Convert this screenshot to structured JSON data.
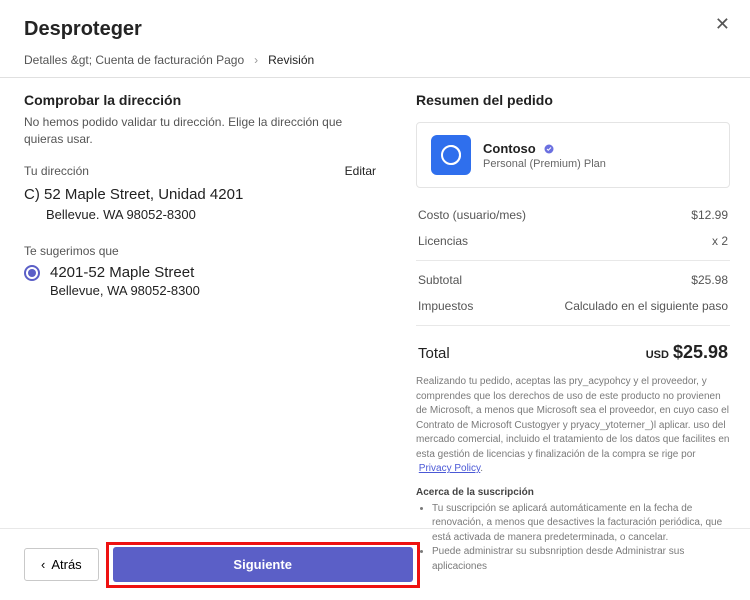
{
  "header": {
    "title": "Desproteger"
  },
  "crumbs": {
    "details": "Detalles &gt; Cuenta de facturación Pago",
    "review": "Revisión"
  },
  "left": {
    "verify_h": "Comprobar la dirección",
    "verify_help": "No hemos podido validar tu dirección. Elige la dirección que quieras usar.",
    "your_addr_lbl": "Tu dirección",
    "edit": "Editar",
    "addr_line1": "C) 52 Maple Street, Unidad 4201",
    "addr_line2": "Bellevue. WA 98052-8300",
    "suggest_lbl": "Te sugerimos que",
    "sug_line1": "4201-52 Maple Street",
    "sug_line2": "Bellevue, WA 98052-8300"
  },
  "right": {
    "summary_h": "Resumen del pedido",
    "product_name": "Contoso",
    "product_plan": "Personal (Premium) Plan",
    "cost_lbl": "Costo (usuario/mes)",
    "cost_val": "$12.99",
    "lic_lbl": "Licencias",
    "lic_val": "x 2",
    "sub_lbl": "Subtotal",
    "sub_val": "$25.98",
    "tax_lbl": "Impuestos",
    "tax_val": "Calculado en el siguiente paso",
    "total_lbl": "Total",
    "total_cur": "USD",
    "total_val": "$25.98",
    "fine1": "Realizando tu pedido, aceptas las pry_acypohcy y el proveedor, y comprendes que los derechos de uso de este producto no provienen de Microsoft, a menos que Microsoft sea el proveedor, en cuyo caso el Contrato de Microsoft Custogyer y pryacy_ytoterner_)l aplicar. uso del mercado comercial, incluido el tratamiento de los datos que facilites en esta gestión de licencias y finalización de la compra se rige por",
    "privacy": "Privacy Policy",
    "about_h": "Acerca de la suscripción",
    "about1": "Tu suscripción se aplicará automáticamente en la fecha de renovación, a menos que desactives la facturación periódica, que está activada de manera predeterminada, o cancelar.",
    "about2": "Puede administrar su subsnription desde Administrar sus aplicaciones"
  },
  "footer": {
    "back": "Atrás",
    "next": "Siguiente"
  }
}
